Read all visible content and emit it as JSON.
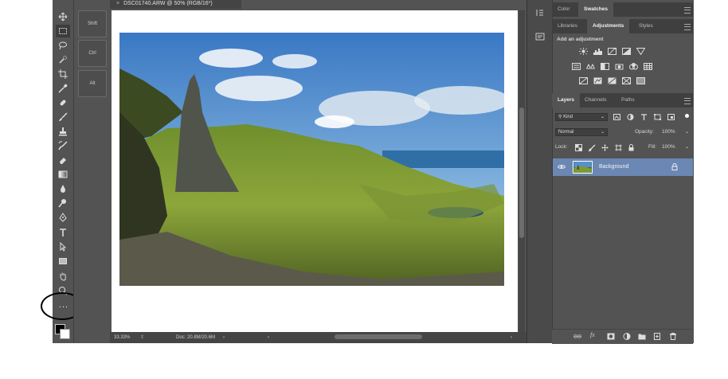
{
  "document": {
    "tab_title": "DSC01740.ARW @ 50% (RGB/16*)",
    "status_zoom": "33.33%",
    "status_doc": "Doc: 20.8M/20.6M"
  },
  "touch_shortcuts": {
    "shift": "Shift",
    "ctrl": "Ctrl",
    "alt": "Alt"
  },
  "toolbar": {
    "tools": [
      "move-tool",
      "marquee-tool",
      "lasso-tool",
      "quick-selection-tool",
      "crop-tool",
      "eyedropper-tool",
      "healing-brush-tool",
      "brush-tool",
      "clone-stamp-tool",
      "history-brush-tool",
      "eraser-tool",
      "gradient-tool",
      "blur-tool",
      "dodge-tool",
      "pen-tool",
      "type-tool",
      "path-selection-tool",
      "rectangle-tool",
      "hand-tool",
      "zoom-tool"
    ],
    "more_label": "..."
  },
  "panels": {
    "top_tabs": [
      "Color",
      "Swatches"
    ],
    "mid_tabs": [
      "Libraries",
      "Adjustments",
      "Styles"
    ],
    "adjustments_heading": "Add an adjustment",
    "layers_tabs": [
      "Layers",
      "Channels",
      "Paths"
    ],
    "kind_label": "Kind",
    "blend_mode": "Normal",
    "opacity_label": "Opacity:",
    "opacity_value": "100%",
    "lock_label": "Lock:",
    "fill_label": "Fill:",
    "fill_value": "100%",
    "layer_name": "Background"
  },
  "colors": {
    "ui_bg": "#535353",
    "selected_layer": "#6b87b3",
    "canvas": "#ffffff"
  }
}
